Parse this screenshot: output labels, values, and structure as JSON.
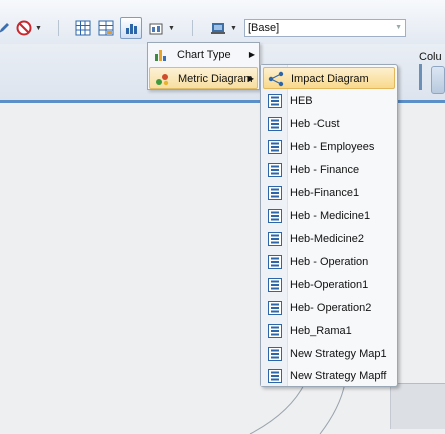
{
  "toolbar": {
    "combo_value": "[Base]",
    "column_label": "Colu"
  },
  "menu1": {
    "items": [
      {
        "label": "Chart Type",
        "icon": "chart-type-icon"
      },
      {
        "label": "Metric Diagram",
        "icon": "metric-diagram-icon"
      }
    ]
  },
  "menu2": {
    "items": [
      {
        "label": "Impact Diagram",
        "icon": "impact-diagram-icon"
      },
      {
        "label": "HEB",
        "icon": "strategy-map-icon"
      },
      {
        "label": "Heb -Cust",
        "icon": "strategy-map-icon"
      },
      {
        "label": "Heb - Employees",
        "icon": "strategy-map-icon"
      },
      {
        "label": "Heb - Finance",
        "icon": "strategy-map-icon"
      },
      {
        "label": "Heb-Finance1",
        "icon": "strategy-map-icon"
      },
      {
        "label": "Heb - Medicine1",
        "icon": "strategy-map-icon"
      },
      {
        "label": "Heb-Medicine2",
        "icon": "strategy-map-icon"
      },
      {
        "label": "Heb - Operation",
        "icon": "strategy-map-icon"
      },
      {
        "label": "Heb-Operation1",
        "icon": "strategy-map-icon"
      },
      {
        "label": "Heb- Operation2",
        "icon": "strategy-map-icon"
      },
      {
        "label": "Heb_Rama1",
        "icon": "strategy-map-icon"
      },
      {
        "label": "New Strategy Map1",
        "icon": "strategy-map-icon"
      },
      {
        "label": "New Strategy Mapff",
        "icon": "strategy-map-icon"
      }
    ]
  },
  "colors": {
    "highlight": "#f8d98c",
    "ribbon_accent": "#5a8fc8"
  }
}
